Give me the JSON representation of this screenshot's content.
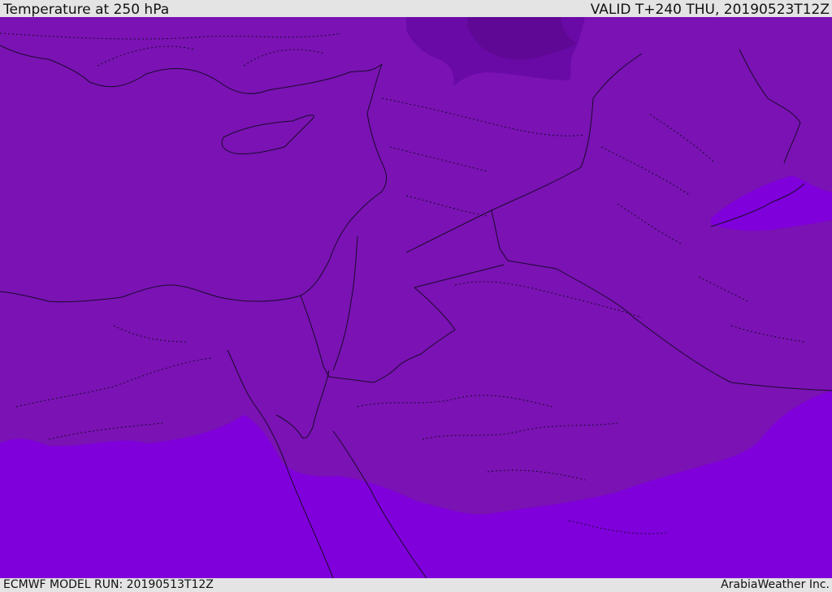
{
  "header": {
    "title": "Temperature at 250 hPa",
    "valid": "VALID T+240 THU, 20190523T12Z"
  },
  "footer": {
    "model_run": "ECMWF MODEL RUN: 20190513T12Z",
    "credit": "ArabiaWeather Inc."
  },
  "map": {
    "field_colors": {
      "base": "#7a12b4",
      "warm": "#7f00db",
      "cold": "#6a0aa6",
      "coldest": "#5f0896"
    },
    "border_color": "#1a0a2a"
  }
}
